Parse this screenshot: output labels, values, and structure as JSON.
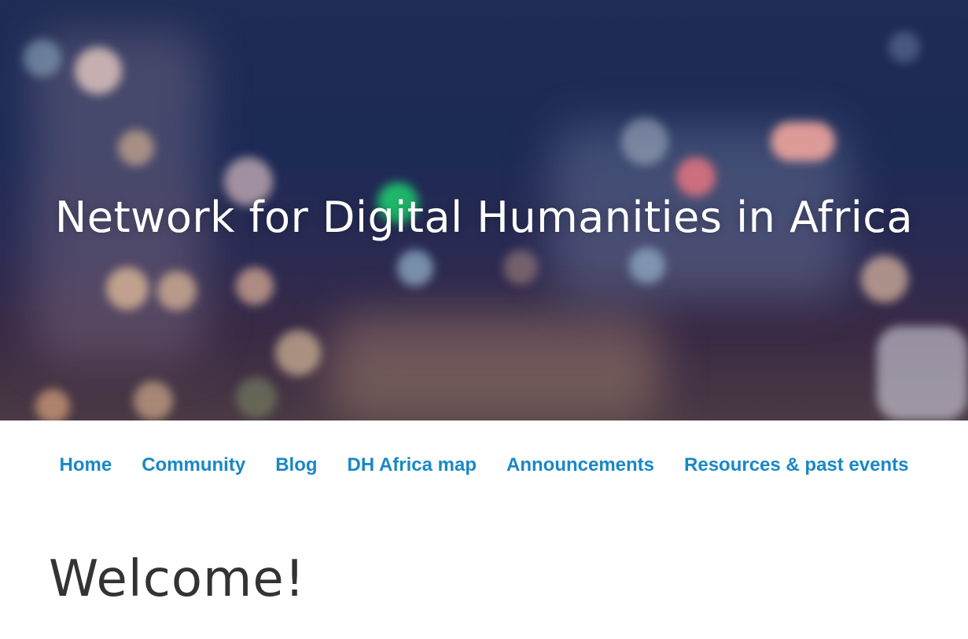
{
  "hero": {
    "title": "Network for Digital Humanities in Africa"
  },
  "nav": {
    "items": [
      {
        "label": "Home"
      },
      {
        "label": "Community"
      },
      {
        "label": "Blog"
      },
      {
        "label": "DH Africa map"
      },
      {
        "label": "Announcements"
      },
      {
        "label": "Resources & past events"
      }
    ]
  },
  "main": {
    "heading": "Welcome!"
  },
  "colors": {
    "link": "#1a88c4",
    "heading": "#333333",
    "hero_text": "#ffffff"
  }
}
